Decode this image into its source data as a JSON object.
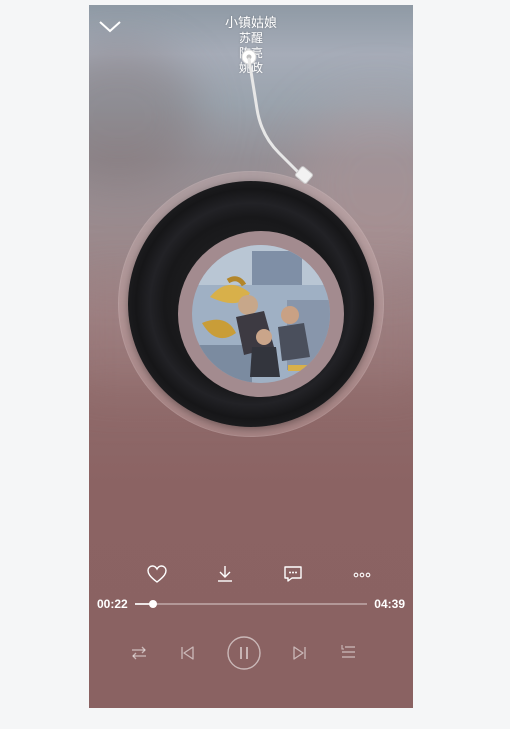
{
  "player": {
    "song_title": "小镇姑娘",
    "artist_lines": [
      "苏醒",
      "陈亮",
      "姚政"
    ]
  },
  "progress": {
    "current_time": "00:22",
    "total_time": "04:39",
    "fraction": 0.079
  },
  "icons": {
    "collapse": "chevron-down-icon",
    "like": "heart-icon",
    "download": "download-icon",
    "comment": "comment-icon",
    "more": "more-icon",
    "mode": "repeat-icon",
    "prev": "previous-icon",
    "play_pause": "pause-icon",
    "next": "next-icon",
    "playlist": "playlist-icon"
  }
}
